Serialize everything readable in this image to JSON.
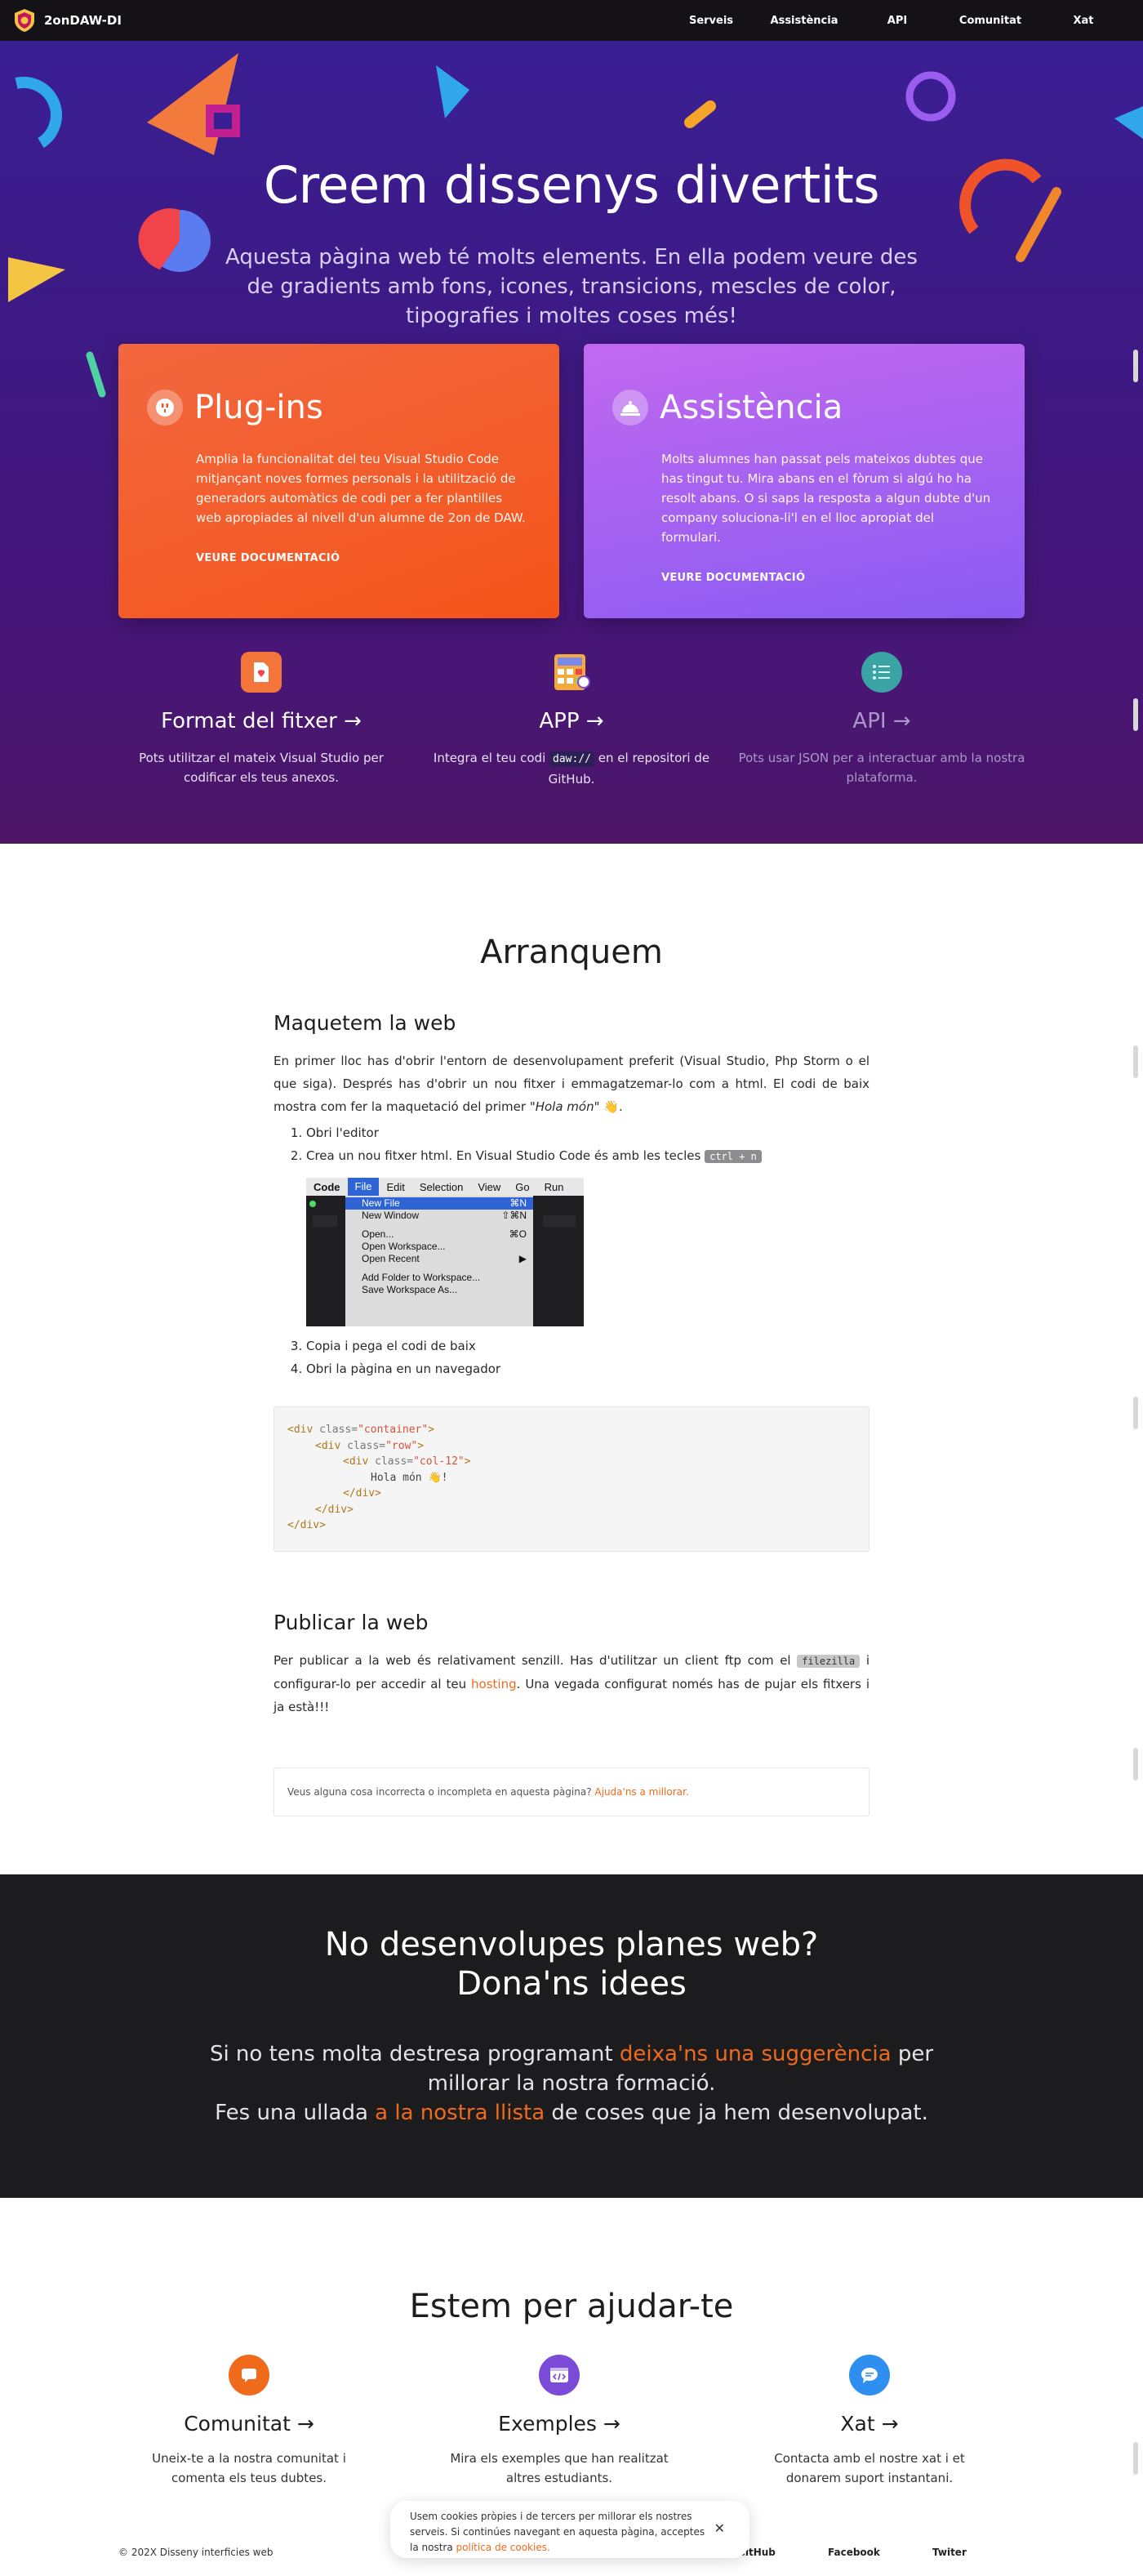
{
  "nav": {
    "brand": "2onDAW-DI",
    "links": [
      "Serveis",
      "Assistència",
      "API",
      "Comunitat",
      "Xat"
    ]
  },
  "hero": {
    "title": "Creem dissenys divertits",
    "subtitle": "Aquesta pàgina web té molts elements. En ella podem veure des de gradients amb fons, icones, transicions, mescles de color, tipografies i moltes coses més!"
  },
  "cards": [
    {
      "title": "Plug-ins",
      "text": "Amplia la funcionalitat del teu Visual Studio Code mitjançant noves formes personals i la utilització de generadors automàtics de codi per a fer plantilles web apropiades al nivell d'un alumne de 2on de DAW.",
      "link": "VEURE DOCUMENTACIÓ"
    },
    {
      "title": "Assistència",
      "text": "Molts alumnes han passat pels mateixos dubtes que has tingut tu. Mira abans en el fòrum si algú ho ha resolt abans. O si saps la resposta a algun dubte d'un company soluciona-li'l en el lloc apropiat del formulari.",
      "link": "VEURE DOCUMENTACIÓ"
    }
  ],
  "features": [
    {
      "title": "Format del fitxer →",
      "text": "Pots utilitzar el mateix Visual Studio per codificar els teus anexos."
    },
    {
      "title": "APP →",
      "text_before": "Integra el teu codi",
      "code": "daw://",
      "text_after": "en el repositori de GitHub."
    },
    {
      "title": "API →",
      "text": "Pots usar JSON per a interactuar amb la nostra plataforma."
    }
  ],
  "docs": {
    "title": "Arranquem",
    "section1": {
      "heading": "Maquetem la web",
      "para_before": "En primer lloc has d'obrir l'entorn de desenvolupament preferit (Visual Studio, Php Storm o el que siga). Després has d'obrir un nou fitxer i emmagatzemar-lo com a html. El codi de baix mostra com fer la maquetació del primer ",
      "para_em": "\"Hola món\"",
      "para_after": " 👋.",
      "steps": [
        "Obri l'editor",
        "Crea un nou fitxer html. En Visual Studio Code és amb les tecles"
      ],
      "kbd": "ctrl + n",
      "steps_after": [
        "Copia i pega el codi de baix",
        "Obri la pàgina en un navegador"
      ],
      "menu_bar": [
        "Code",
        "File",
        "Edit",
        "Selection",
        "View",
        "Go",
        "Run"
      ],
      "menu_items": [
        {
          "label": "New File",
          "shortcut": "⌘N",
          "selected": true
        },
        {
          "label": "New Window",
          "shortcut": "⇧⌘N"
        },
        {
          "label": "Open...",
          "shortcut": "⌘O"
        },
        {
          "label": "Open Workspace...",
          "shortcut": ""
        },
        {
          "label": "Open Recent",
          "shortcut": "▶"
        },
        {
          "label": "Add Folder to Workspace...",
          "shortcut": ""
        },
        {
          "label": "Save Workspace As...",
          "shortcut": ""
        }
      ],
      "code_lines": [
        {
          "indent": 0,
          "tag": "div",
          "attr": "class",
          "val": "container"
        },
        {
          "indent": 1,
          "tag": "div",
          "attr": "class",
          "val": "row"
        },
        {
          "indent": 2,
          "tag": "div",
          "attr": "class",
          "val": "col-12"
        },
        {
          "indent": 3,
          "text": "Hola món 👋!"
        },
        {
          "indent": 2,
          "close": "div"
        },
        {
          "indent": 1,
          "close": "div"
        },
        {
          "indent": 0,
          "close": "div"
        }
      ]
    },
    "section2": {
      "heading": "Publicar la web",
      "para_a": "Per publicar a la web és relativament senzill. Has d'utilitzar un client ftp com el",
      "kbd": "filezilla",
      "para_b": "i configurar-lo per accedir al teu",
      "link": "hosting",
      "para_c": ". Una vegada configurat només has de pujar els fitxers i ja està!!!"
    },
    "note": {
      "text": "Veus alguna cosa incorrecta o incompleta en aquesta pàgina?",
      "link": "Ajuda'ns a millorar."
    }
  },
  "cta": {
    "title_line1": "No desenvolupes planes web?",
    "title_line2": "Dona'ns idees",
    "p1_a": "Si no tens molta destresa programant",
    "p1_link": "deixa'ns una suggerència",
    "p1_b": "per millorar la nostra formació.",
    "p2_a": "Fes una ullada",
    "p2_link": "a la nostra llista",
    "p2_b": "de coses que ja hem desenvolupat."
  },
  "help": {
    "title": "Estem per ajudar-te",
    "cols": [
      {
        "title": "Comunitat →",
        "text": "Uneix-te a la nostra comunitat i comenta els teus dubtes.",
        "color": "#f06a1b"
      },
      {
        "title": "Exemples →",
        "text": "Mira els exemples que han realitzat altres estudiants.",
        "color": "#7b4ad6"
      },
      {
        "title": "Xat →",
        "text": "Contacta amb el nostre xat i et donarem suport instantani.",
        "color": "#2f8ff0"
      }
    ]
  },
  "footer": {
    "copyright": "© 202X Disseny interficies web",
    "links": [
      "GitHub",
      "Facebook",
      "Twiter"
    ]
  },
  "cookie": {
    "text": "Usem cookies pròpies i de tercers per millorar els nostres serveis. Si continúes navegant en aquesta pàgina, acceptes la nostra",
    "link": "política de cookies.",
    "close": "✕"
  },
  "colors": {
    "accent": "#f06a1b",
    "hero_bg": "#3a1f93",
    "dark_bg": "#1c1c1e"
  }
}
